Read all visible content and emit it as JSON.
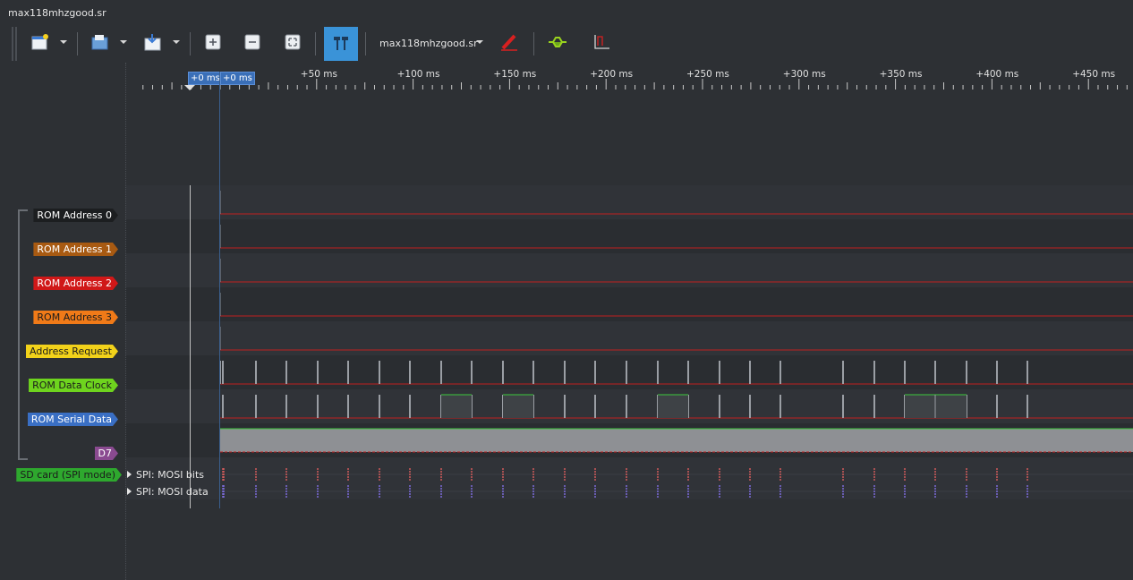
{
  "window": {
    "title": "max118mhzgood.sr"
  },
  "toolbar": {
    "session_name": "max118mhzgood.sr",
    "buttons": [
      {
        "name": "new-session-icon"
      },
      {
        "name": "open-icon"
      },
      {
        "name": "save-icon"
      },
      {
        "name": "zoom-in-icon"
      },
      {
        "name": "zoom-out-icon"
      },
      {
        "name": "zoom-fit-icon"
      },
      {
        "name": "cursor-toggle-icon"
      },
      {
        "name": "device-config-icon"
      },
      {
        "name": "decoder-icon"
      },
      {
        "name": "measure-icon"
      }
    ]
  },
  "ruler": {
    "cursor_labels": [
      "+0 ms",
      "+0 ms"
    ],
    "ticks": [
      "+50 ms",
      "+100 ms",
      "+150 ms",
      "+200 ms",
      "+250 ms",
      "+300 ms",
      "+350 ms",
      "+400 ms",
      "+450 ms"
    ]
  },
  "channels": [
    {
      "label": "ROM Address 0",
      "color": "#1c1e20",
      "text": "#ffffff"
    },
    {
      "label": "ROM Address 1",
      "color": "#a85a12",
      "text": "#ffffff"
    },
    {
      "label": "ROM Address 2",
      "color": "#d01818",
      "text": "#ffffff"
    },
    {
      "label": "ROM Address 3",
      "color": "#f07a18",
      "text": "#1c1c1c"
    },
    {
      "label": "Address Request",
      "color": "#f2d21a",
      "text": "#1c1c1c"
    },
    {
      "label": "ROM Data Clock",
      "color": "#6ed41e",
      "text": "#1c1c1c"
    },
    {
      "label": "ROM Serial Data",
      "color": "#3a6fc4",
      "text": "#ffffff"
    },
    {
      "label": "D7",
      "color": "#8a4a90",
      "text": "#ffffff"
    }
  ],
  "decoder": {
    "label": "SD card (SPI mode)",
    "color": "#2ea82e",
    "rows": [
      "SPI: MOSI bits",
      "SPI: MOSI data"
    ]
  },
  "colors": {
    "accent": "#3a93d8",
    "low_line": "#c02020",
    "high_line": "#3cc83c"
  }
}
